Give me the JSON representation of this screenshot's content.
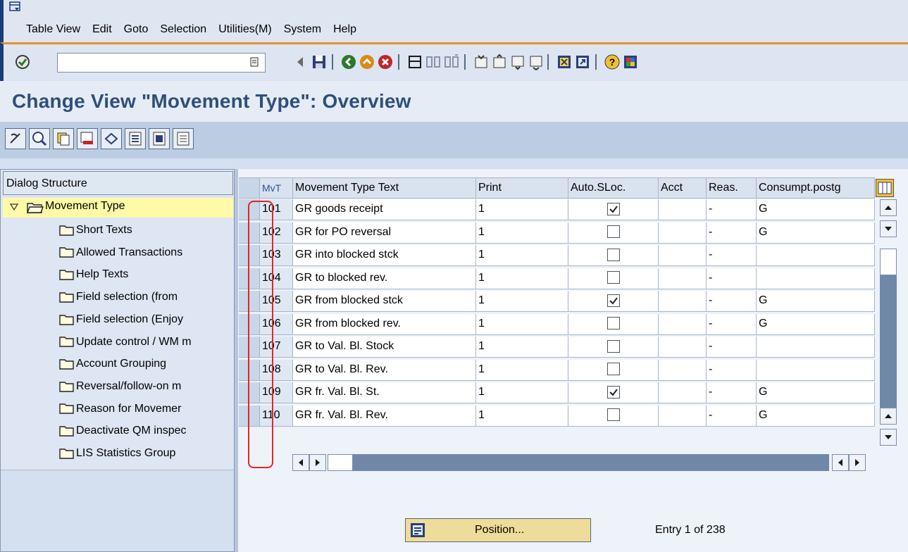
{
  "menu": {
    "items": [
      "Table View",
      "Edit",
      "Goto",
      "Selection",
      "Utilities(M)",
      "System",
      "Help"
    ]
  },
  "toolbar": {
    "command_field_value": "",
    "icons": [
      "enter-icon",
      "back-icon",
      "save-icon",
      "exit-icon",
      "up-icon",
      "cancel-icon",
      "print-icon",
      "find-icon",
      "find-next-icon",
      "first-page-icon",
      "prev-page-icon",
      "next-page-icon",
      "last-page-icon",
      "create-session-icon",
      "shortcut-icon",
      "help-icon",
      "layout-icon"
    ]
  },
  "title": "Change View \"Movement Type\": Overview",
  "app_toolbar": {
    "icons": [
      "display-change-icon",
      "details-icon",
      "copy-as-icon",
      "delete-icon",
      "undo-change-icon",
      "select-all-icon",
      "select-block-icon",
      "deselect-all-icon"
    ]
  },
  "dialog_structure": {
    "header": "Dialog Structure",
    "root": "Movement Type",
    "children": [
      "Short Texts",
      "Allowed Transactions",
      "Help Texts",
      "Field selection (from",
      "Field selection (Enjoy",
      "Update control / WM m",
      "Account Grouping",
      "Reversal/follow-on m",
      "Reason for Movemer",
      "Deactivate QM inspec",
      "LIS Statistics Group"
    ]
  },
  "table": {
    "columns": [
      "MvT",
      "Movement Type Text",
      "Print",
      "Auto.SLoc.",
      "Acct",
      "Reas.",
      "Consumpt.postg"
    ],
    "rows": [
      {
        "mvt": "101",
        "text": "GR goods receipt",
        "print": "1",
        "auto": true,
        "acct": "",
        "reas": "-",
        "cons": "G"
      },
      {
        "mvt": "102",
        "text": "GR for PO   reversal",
        "print": "1",
        "auto": false,
        "acct": "",
        "reas": "-",
        "cons": "G"
      },
      {
        "mvt": "103",
        "text": "GR into blocked stck",
        "print": "1",
        "auto": false,
        "acct": "",
        "reas": "-",
        "cons": ""
      },
      {
        "mvt": "104",
        "text": "GR to blocked rev.",
        "print": "1",
        "auto": false,
        "acct": "",
        "reas": "-",
        "cons": ""
      },
      {
        "mvt": "105",
        "text": "GR from blocked stck",
        "print": "1",
        "auto": true,
        "acct": "",
        "reas": "-",
        "cons": "G"
      },
      {
        "mvt": "106",
        "text": "GR from blocked rev.",
        "print": "1",
        "auto": false,
        "acct": "",
        "reas": "-",
        "cons": "G"
      },
      {
        "mvt": "107",
        "text": "GR to Val. Bl. Stock",
        "print": "1",
        "auto": false,
        "acct": "",
        "reas": "-",
        "cons": ""
      },
      {
        "mvt": "108",
        "text": "GR to Val. Bl. Rev.",
        "print": "1",
        "auto": false,
        "acct": "",
        "reas": "-",
        "cons": ""
      },
      {
        "mvt": "109",
        "text": "GR fr. Val. Bl. St.",
        "print": "1",
        "auto": true,
        "acct": "",
        "reas": "-",
        "cons": "G"
      },
      {
        "mvt": "110",
        "text": "GR fr. Val. Bl. Rev.",
        "print": "1",
        "auto": false,
        "acct": "",
        "reas": "-",
        "cons": "G"
      }
    ]
  },
  "position_button": "Position...",
  "entry_info": "Entry 1 of 238",
  "colors": {
    "title": "#2f4f7a",
    "accent_line": "#e88f2f",
    "highlight": "#e0262a",
    "tree_selected": "#fffaa8"
  }
}
